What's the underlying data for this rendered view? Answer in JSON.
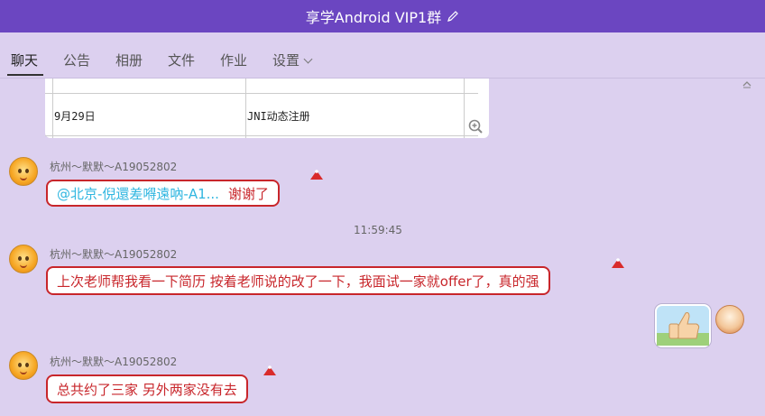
{
  "window": {
    "title": "享学Android  VIP1群"
  },
  "tabs": [
    {
      "label": "聊天",
      "active": true
    },
    {
      "label": "公告"
    },
    {
      "label": "相册"
    },
    {
      "label": "文件"
    },
    {
      "label": "作业"
    },
    {
      "label": "设置"
    }
  ],
  "doc_preview": {
    "row": {
      "date": "9月29日",
      "topic": "JNI动态注册"
    }
  },
  "messages": [
    {
      "sender": "杭州～默默～A19052802",
      "mention": "@北京-倪還差嘚遠吶-A1...",
      "text": "谢谢了"
    },
    {
      "timestamp": "11:59:45"
    },
    {
      "sender": "杭州～默默～A19052802",
      "text": "上次老师帮我看一下简历  按着老师说的改了一下，我面试一家就offer了，真的强"
    },
    {
      "sticker": "thumbs-up"
    },
    {
      "sender": "杭州～默默～A19052802",
      "text": "总共约了三家 另外两家没有去"
    }
  ],
  "colors": {
    "titlebar": "#6b46c1",
    "background": "#dcd0ef",
    "bubble_text": "#c8262b",
    "mention": "#2fb6e0"
  }
}
